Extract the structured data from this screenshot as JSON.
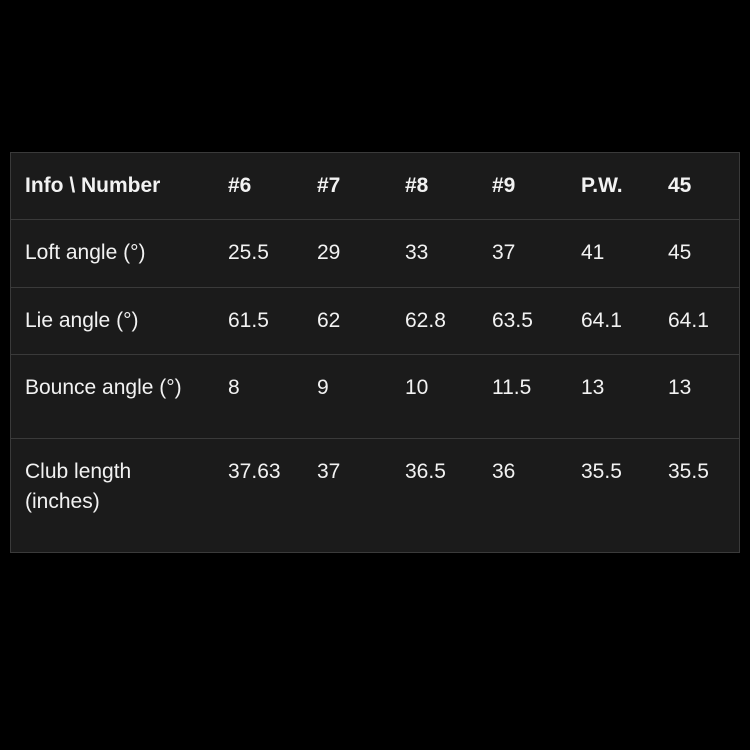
{
  "table": {
    "corner_label": "Info \\ Number",
    "columns": [
      "#6",
      "#7",
      "#8",
      "#9",
      "P.W.",
      "45"
    ],
    "rows": [
      {
        "label": "Loft angle (°)",
        "values": [
          "25.5",
          "29",
          "33",
          "37",
          "41",
          "45"
        ],
        "wraps": false
      },
      {
        "label": "Lie angle (°)",
        "values": [
          "61.5",
          "62",
          "62.8",
          "63.5",
          "64.1",
          "64.1"
        ],
        "wraps": false
      },
      {
        "label": "Bounce angle (°)",
        "values": [
          "8",
          "9",
          "10",
          "11.5",
          "13",
          "13"
        ],
        "wraps": true
      },
      {
        "label": "Club length (inches)",
        "values": [
          "37.63",
          "37",
          "36.5",
          "36",
          "35.5",
          "35.5"
        ],
        "wraps": true
      }
    ]
  },
  "colors": {
    "page_background": "#000000",
    "table_background": "#1b1b1b",
    "border": "#3a3a3a",
    "text": "#f2f2f2"
  }
}
